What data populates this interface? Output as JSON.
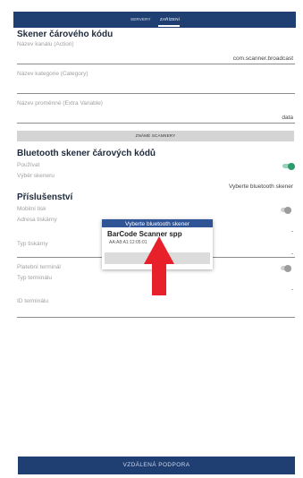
{
  "tabs": [
    {
      "label": "SERVERY",
      "active": false
    },
    {
      "label": "ZAŘÍZENÍ",
      "active": true
    }
  ],
  "barcode_scanner": {
    "section_title": "Skener čárového kódu",
    "channel_label": "Název kanálu (Action)",
    "channel_value": "com.scanner.broadcast",
    "category_label": "Název kategorie (Category)",
    "category_value": "",
    "variable_label": "Název proměnné (Extra Variable)",
    "variable_value": "data",
    "known_scanners_button": "ZNÁMÉ SCANNERY"
  },
  "bluetooth": {
    "section_title": "Bluetooth skener čárových kódů",
    "use_label": "Používat",
    "use_enabled": true,
    "select_label": "Výběr skeneru",
    "select_value": "Vyberte bluetooth skener"
  },
  "accessories": {
    "section_title": "Příslušenství",
    "mobile_print_label": "Mobilní tisk",
    "mobile_print_enabled": false,
    "printer_address_label": "Adresa tiskárny",
    "printer_address_value": "-",
    "printer_type_label": "Typ tiskárny",
    "printer_type_value": "-",
    "payment_terminal_label": "Platební terminál",
    "payment_terminal_enabled": false,
    "terminal_type_label": "Typ terminálu",
    "terminal_type_value": "-",
    "terminal_id_label": "ID terminálu",
    "terminal_id_value": ""
  },
  "dialog": {
    "title": "Vyberte bluetooth skener",
    "device_name": "BarCode Scanner spp",
    "device_mac": "AA:A8:A1:12:05:01"
  },
  "remote_support_button": "VZDÁLENÁ PODPORA",
  "colors": {
    "navy": "#1f3f73",
    "dialog_header": "#2f5597",
    "toggle_on": "#2c9b6c",
    "annotation_arrow": "#e8202a"
  }
}
